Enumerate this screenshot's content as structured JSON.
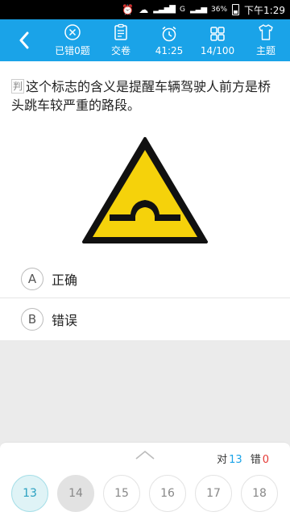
{
  "status_bar": {
    "battery_pct": "36%",
    "time": "下午1:29",
    "network": "G"
  },
  "toolbar": {
    "items": [
      {
        "label": "已错0题",
        "icon": "close-circle-icon"
      },
      {
        "label": "交卷",
        "icon": "submit-paper-icon"
      },
      {
        "label": "41:25",
        "icon": "alarm-clock-icon"
      },
      {
        "label": "14/100",
        "icon": "grid-icon"
      },
      {
        "label": "主题",
        "icon": "shirt-icon"
      }
    ]
  },
  "question": {
    "type_tag": "判",
    "text": "这个标志的含义是提醒车辆驾驶人前方是桥头跳车较严重的路段。",
    "sign_colors": {
      "fill": "#f5d20b",
      "border": "#111111"
    }
  },
  "options": [
    {
      "letter": "A",
      "text": "正确"
    },
    {
      "letter": "B",
      "text": "错误"
    }
  ],
  "bottom": {
    "right_label": "对",
    "right_count": "13",
    "wrong_label": "错",
    "wrong_count": "0",
    "question_numbers": [
      "13",
      "14",
      "15",
      "16",
      "17",
      "18"
    ]
  },
  "colors": {
    "toolbar": "#1aa3e8",
    "correct": "#1aa3e8",
    "wrong": "#e53935"
  }
}
